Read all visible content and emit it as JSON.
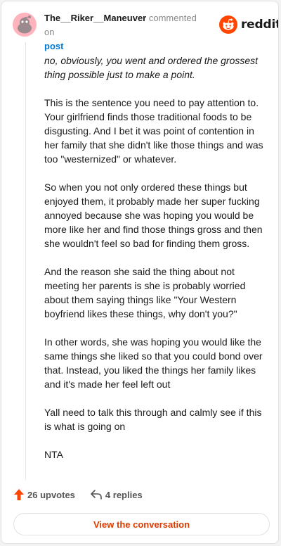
{
  "header": {
    "username": "The__Riker__Maneuver",
    "commented_on": "commented on",
    "post_link": "post",
    "brand": "reddit"
  },
  "comment": {
    "quote": "no, obviously, you went and ordered the grossest thing possible just to make a point.",
    "paragraphs": [
      "This is the sentence you need to pay attention to. Your girlfriend finds those traditional foods to be disgusting. And I bet it was point of contention in her family that she didn't like those things and was too \"westernized\" or whatever.",
      "So when you not only ordered these things but enjoyed them, it probably made her super fucking annoyed because she was hoping you would be more like her and find those things gross and then she wouldn't feel so bad for finding them gross.",
      "And the reason she said the thing about not meeting her parents is she is probably worried about them saying things like \"Your Western boyfriend likes these things, why don't you?\"",
      "In other words, she was hoping you would like the same things she liked so that you could bond over that. Instead, you liked the things her family likes and it's made her feel left out",
      "Yall need to talk this through and calmly see if this is what is going on",
      "NTA"
    ]
  },
  "actions": {
    "upvotes": "26 upvotes",
    "replies": "4 replies",
    "view_button": "View the conversation"
  },
  "icons": {
    "avatar": "snoo-avatar-icon",
    "logo": "reddit-logo-icon",
    "upvote": "upvote-arrow-icon",
    "reply": "reply-arrow-icon"
  },
  "colors": {
    "brand_orange": "#ff4500",
    "link_blue": "#0079d3",
    "button_text": "#d93a00",
    "avatar_bg": "#ffb3bd"
  }
}
